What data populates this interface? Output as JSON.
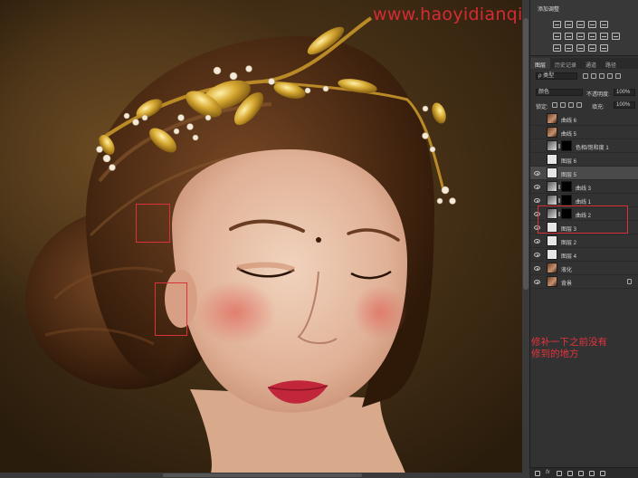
{
  "watermark": "www.haoyidianqingzhi.com",
  "adjustments": {
    "title": "添加调整"
  },
  "layers_panel": {
    "tabs": [
      "图层",
      "历史记录",
      "通道",
      "路径"
    ],
    "filter_kind": "ρ 类型",
    "blend_mode": "颜色",
    "opacity_label": "不透明度:",
    "opacity_value": "100%",
    "lock_label": "锁定:",
    "fill_label": "填充:",
    "fill_value": "100%",
    "layers": [
      {
        "name": "曲线 6",
        "thumb": "photo",
        "visible": false,
        "mask": false,
        "selected": false
      },
      {
        "name": "曲线 5",
        "thumb": "photo",
        "visible": false,
        "mask": false,
        "selected": false
      },
      {
        "name": "色相/饱和度 1",
        "thumb": "adjust",
        "visible": false,
        "mask": true,
        "selected": false
      },
      {
        "name": "图层 6",
        "thumb": "white",
        "visible": false,
        "mask": false,
        "selected": false
      },
      {
        "name": "图层 5",
        "thumb": "white",
        "visible": true,
        "mask": false,
        "selected": true
      },
      {
        "name": "曲线 3",
        "thumb": "adjust",
        "visible": true,
        "mask": true,
        "selected": false
      },
      {
        "name": "曲线 1",
        "thumb": "adjust",
        "visible": true,
        "mask": true,
        "selected": false
      },
      {
        "name": "曲线 2",
        "thumb": "adjust",
        "visible": true,
        "mask": true,
        "selected": false
      },
      {
        "name": "图层 3",
        "thumb": "white",
        "visible": true,
        "mask": false,
        "selected": false
      },
      {
        "name": "图层 2",
        "thumb": "white",
        "visible": true,
        "mask": false,
        "selected": false
      },
      {
        "name": "图层 4",
        "thumb": "white",
        "visible": true,
        "mask": false,
        "selected": false
      },
      {
        "name": "液化",
        "thumb": "photo",
        "visible": true,
        "mask": false,
        "selected": false
      },
      {
        "name": "背景",
        "thumb": "photo",
        "visible": true,
        "mask": false,
        "selected": false,
        "locked": true
      }
    ]
  },
  "note": {
    "line1": "修补一下之前没有",
    "line2": "修到的地方"
  },
  "footer": {
    "fx_label": "fx"
  },
  "colors": {
    "annotation_red": "#d8323a",
    "panel_bg": "#323232"
  }
}
